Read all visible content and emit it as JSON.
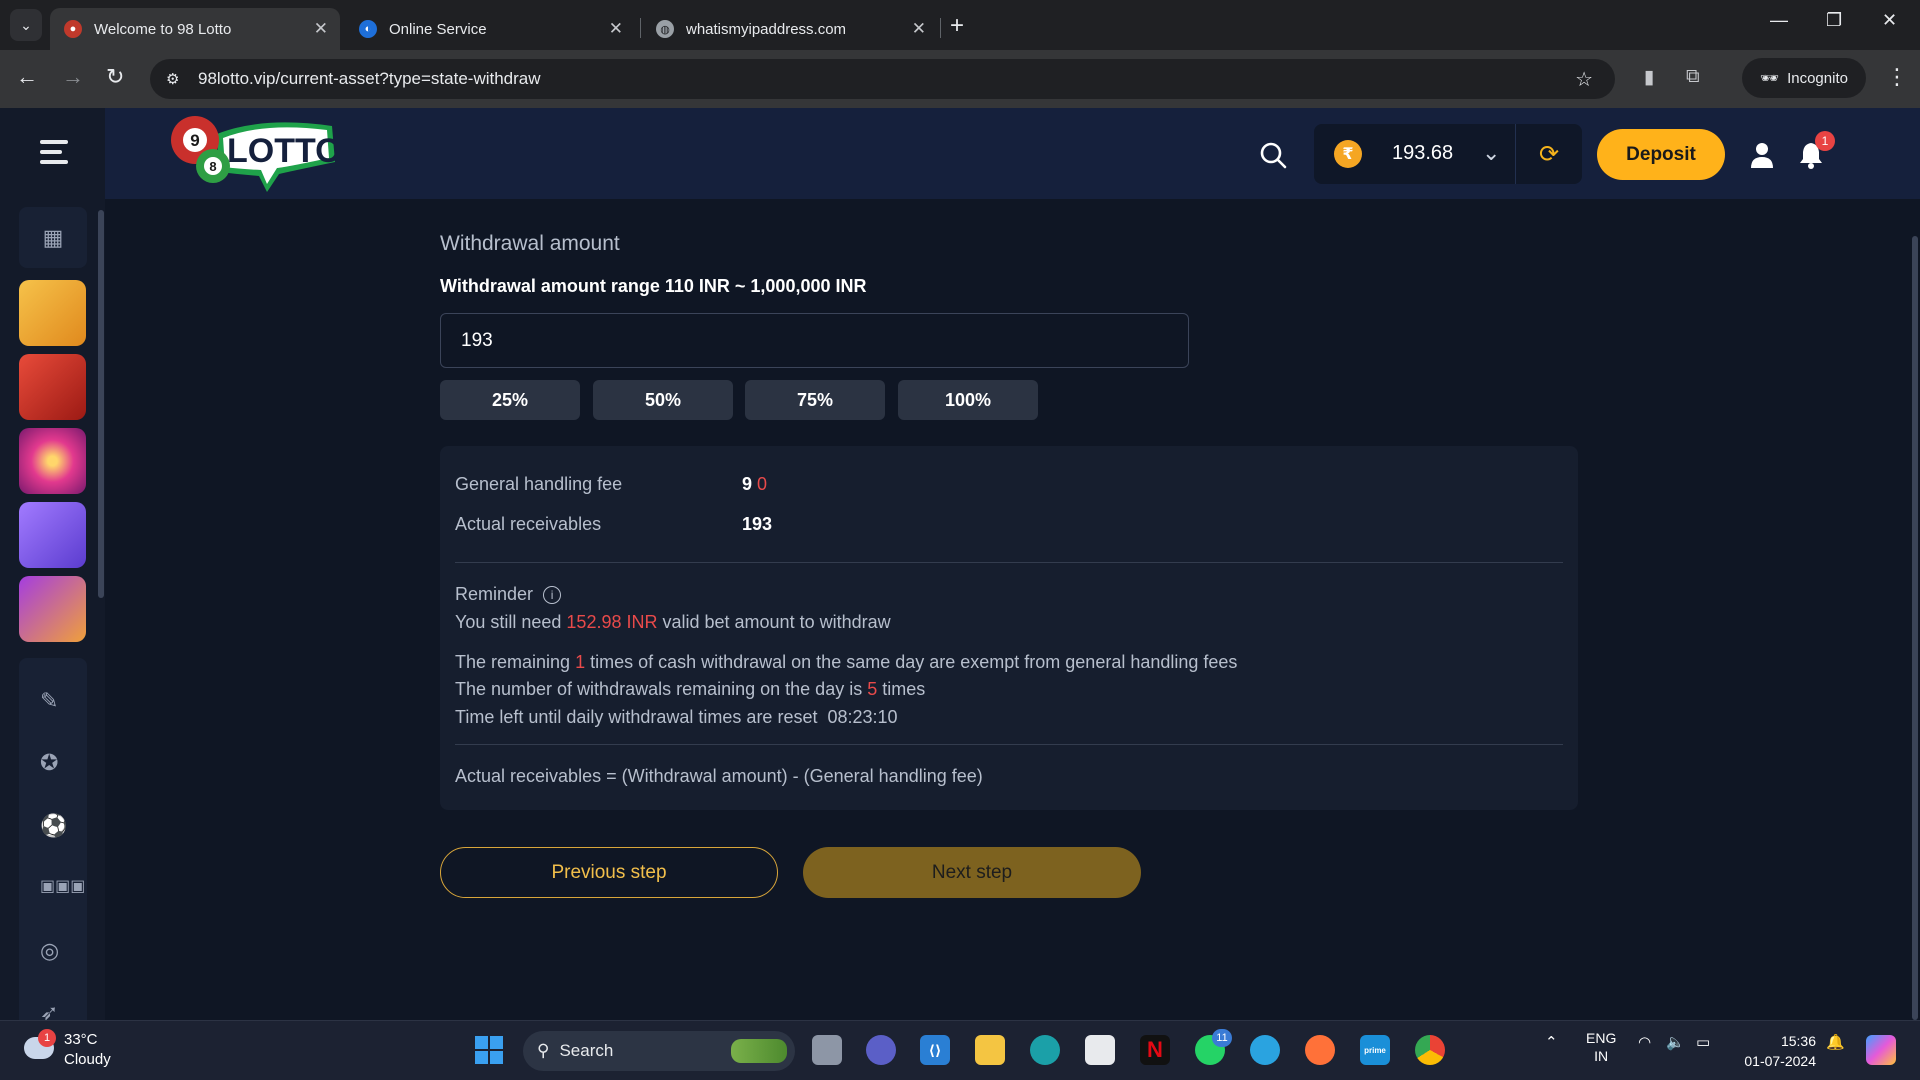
{
  "browser": {
    "tabs": [
      {
        "title": "Welcome to 98 Lotto",
        "active": true
      },
      {
        "title": "Online Service",
        "active": false
      },
      {
        "title": "whatismyipaddress.com",
        "active": false
      }
    ],
    "url": "98lotto.vip/current-asset?type=state-withdraw",
    "incognito_label": "Incognito"
  },
  "header": {
    "logo_text": "LOTTO",
    "balance": "193.68",
    "currency_symbol": "₹",
    "deposit_label": "Deposit",
    "notification_count": "1"
  },
  "withdraw": {
    "title": "Withdrawal amount",
    "range_text": "Withdrawal amount range 110 INR ~ 1,000,000 INR",
    "amount_value": "193",
    "percent_buttons": [
      "25%",
      "50%",
      "75%",
      "100%"
    ],
    "fee_label": "General handling fee",
    "fee_value": "9",
    "fee_value_red": "0",
    "receivable_label": "Actual receivables",
    "receivable_value": "193",
    "reminder_label": "Reminder",
    "reminder_line1_pre": "You still need ",
    "reminder_line1_red": "152.98 INR",
    "reminder_line1_post": " valid bet amount to withdraw",
    "line2_pre": "The remaining ",
    "line2_red": "1",
    "line2_post": " times of cash withdrawal on the same day are exempt from general handling fees",
    "line3_pre": "The number of withdrawals remaining on the day is ",
    "line3_red": "5",
    "line3_post": " times",
    "line4": "Time left until daily withdrawal times are reset  08:23:10",
    "formula": "Actual receivables = (Withdrawal amount) - (General handling fee)",
    "prev_label": "Previous step",
    "next_label": "Next step"
  },
  "taskbar": {
    "weather_temp": "33°C",
    "weather_desc": "Cloudy",
    "weather_badge": "1",
    "search_label": "Search",
    "whatsapp_badge": "11",
    "lang_top": "ENG",
    "lang_bottom": "IN",
    "time": "15:36",
    "date": "01-07-2024"
  },
  "colors": {
    "accent": "#ffb21a",
    "danger": "#e84a4a",
    "header_bg": "#15203c",
    "page_bg": "#0f1624"
  }
}
